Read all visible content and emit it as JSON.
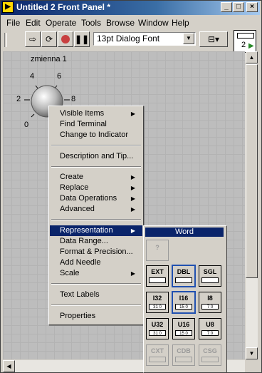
{
  "window": {
    "title": "Untitled 2 Front Panel *",
    "caption_buttons": [
      "_",
      "□",
      "×"
    ]
  },
  "menubar": [
    "File",
    "Edit",
    "Operate",
    "Tools",
    "Browse",
    "Window",
    "Help"
  ],
  "toolbar": {
    "font": "13pt Dialog Font",
    "vi_icon_number": "2"
  },
  "knob": {
    "label": "zmienna 1",
    "ticks": [
      "0",
      "2",
      "4",
      "6",
      "8"
    ]
  },
  "context_menu": {
    "items": [
      {
        "label": "Visible Items",
        "submenu": true
      },
      {
        "label": "Find Terminal",
        "submenu": false
      },
      {
        "label": "Change to Indicator",
        "submenu": false
      },
      {
        "label": "Description and Tip...",
        "submenu": false
      },
      {
        "label": "Create",
        "submenu": true
      },
      {
        "label": "Replace",
        "submenu": true
      },
      {
        "label": "Data Operations",
        "submenu": true
      },
      {
        "label": "Advanced",
        "submenu": true
      },
      {
        "label": "Representation",
        "submenu": true,
        "highlighted": true
      },
      {
        "label": "Data Range...",
        "submenu": false
      },
      {
        "label": "Format & Precision...",
        "submenu": false
      },
      {
        "label": "Add Needle",
        "submenu": false
      },
      {
        "label": "Scale",
        "submenu": true
      },
      {
        "label": "Text Labels",
        "submenu": false
      },
      {
        "label": "Properties",
        "submenu": false
      }
    ]
  },
  "representation": {
    "title": "Word",
    "unknown": "?",
    "types": [
      {
        "label": "EXT",
        "bar": "",
        "selected": false,
        "disabled": false
      },
      {
        "label": "DBL",
        "bar": "",
        "selected": true,
        "disabled": false
      },
      {
        "label": "SGL",
        "bar": "",
        "selected": false,
        "disabled": false
      },
      {
        "label": "I32",
        "bar": "31 0",
        "selected": false,
        "disabled": false
      },
      {
        "label": "I16",
        "bar": "15 0",
        "selected": true,
        "disabled": false
      },
      {
        "label": "I8",
        "bar": "7 0",
        "selected": false,
        "disabled": false
      },
      {
        "label": "U32",
        "bar": "31 0",
        "selected": false,
        "disabled": false
      },
      {
        "label": "U16",
        "bar": "15 0",
        "selected": false,
        "disabled": false
      },
      {
        "label": "U8",
        "bar": "7 0",
        "selected": false,
        "disabled": false
      },
      {
        "label": "CXT",
        "bar": "",
        "selected": false,
        "disabled": true
      },
      {
        "label": "CDB",
        "bar": "",
        "selected": false,
        "disabled": true
      },
      {
        "label": "CSG",
        "bar": "",
        "selected": false,
        "disabled": true
      }
    ]
  }
}
